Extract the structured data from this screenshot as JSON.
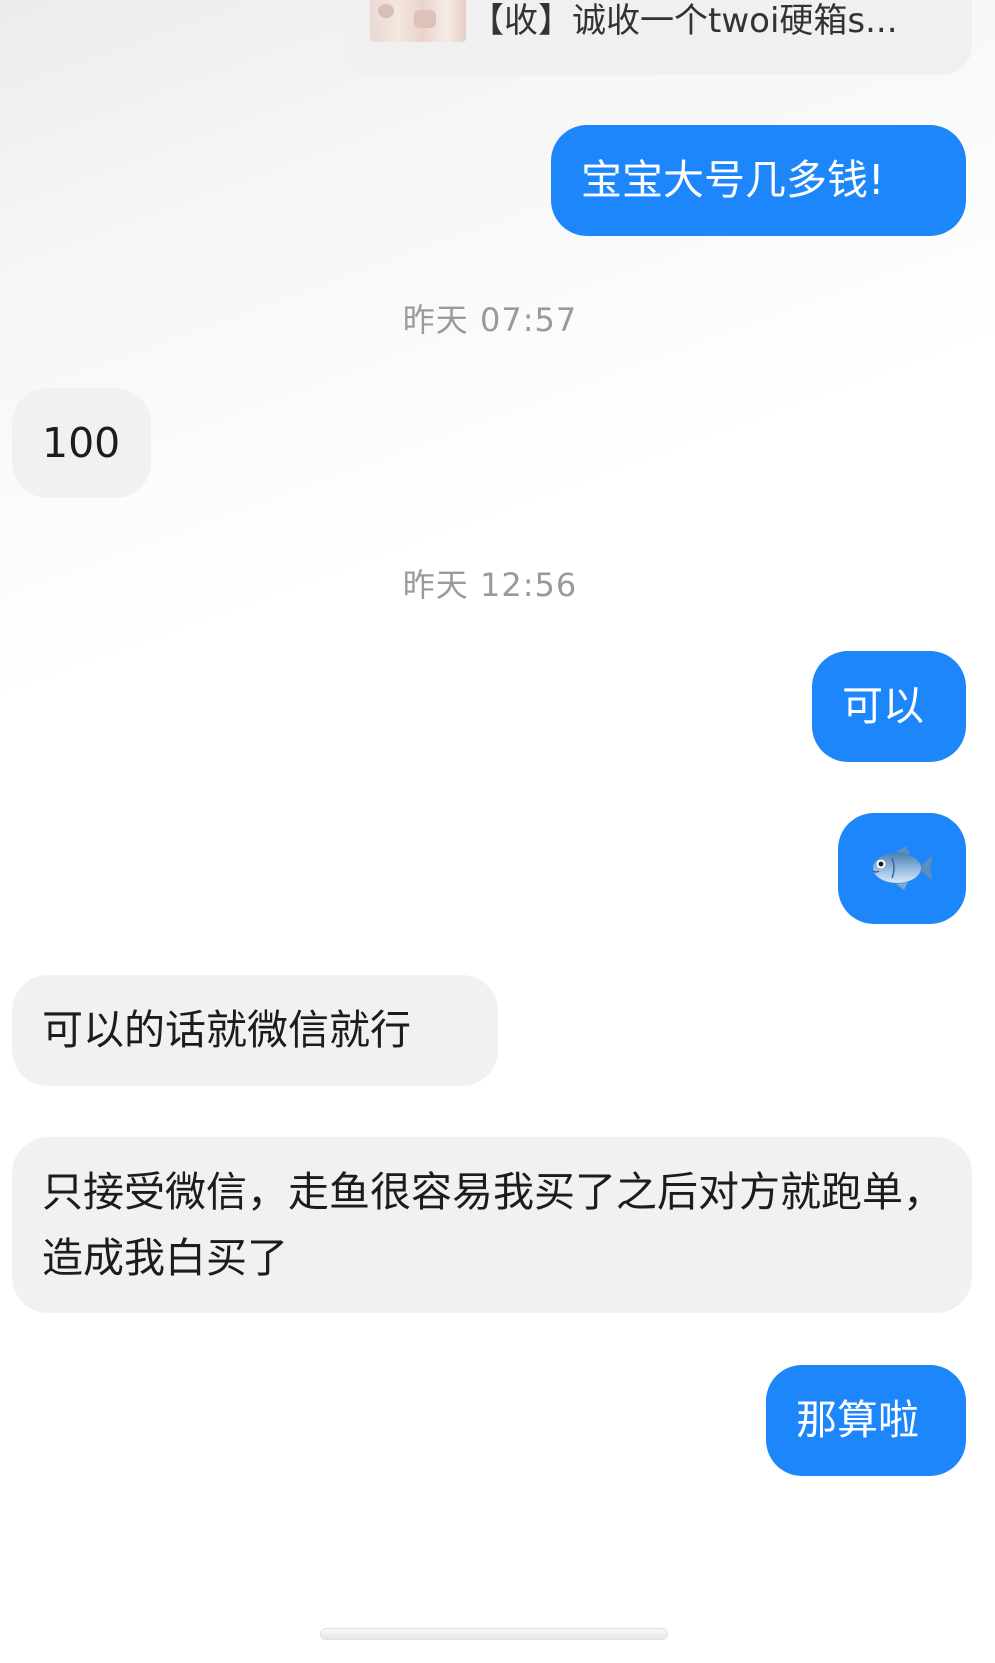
{
  "quoted_item": {
    "title": "【收】诚收一个twoi硬箱s..."
  },
  "messages": [
    {
      "side": "sent",
      "text": "宝宝大号几多钱!"
    },
    {
      "type": "timestamp",
      "text": "昨天 07:57"
    },
    {
      "side": "received",
      "text": "100"
    },
    {
      "type": "timestamp",
      "text": "昨天 12:56"
    },
    {
      "side": "sent",
      "text": "可以"
    },
    {
      "side": "sent",
      "emoji": "fish-icon"
    },
    {
      "side": "received",
      "text": "可以的话就微信就行"
    },
    {
      "side": "received",
      "text": "只接受微信，走鱼很容易我买了之后对方就跑单，造成我白买了"
    },
    {
      "side": "sent",
      "text": "那算啦"
    }
  ],
  "colors": {
    "sent_bubble": "#1e86fb",
    "received_bubble": "#f1f1f1",
    "timestamp_text": "#9a9a9a"
  }
}
